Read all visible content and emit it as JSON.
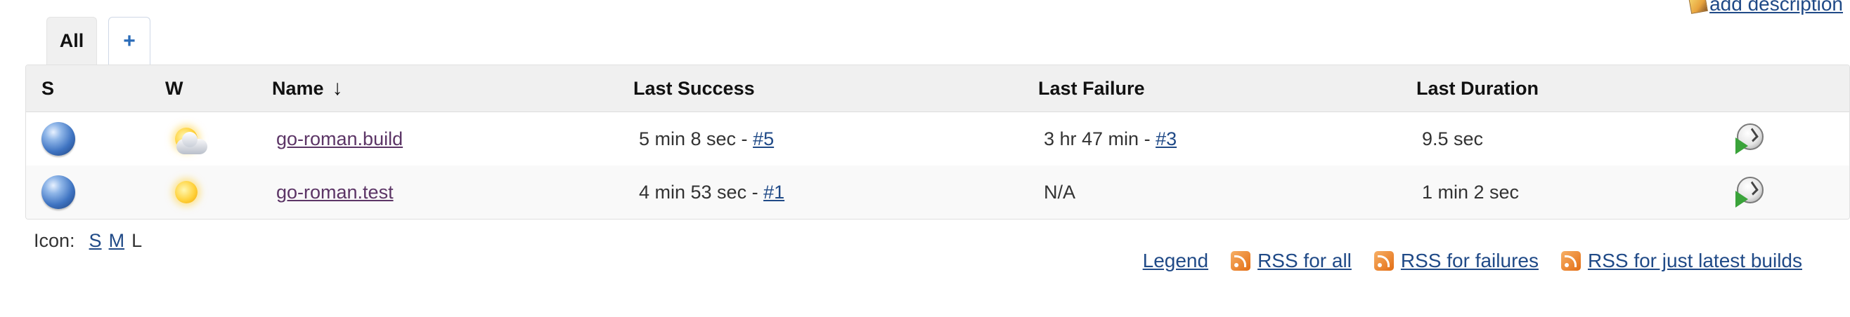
{
  "header": {
    "add_description": "add description"
  },
  "tabs": [
    {
      "label": "All",
      "active": true
    },
    {
      "label": "+",
      "active": false
    }
  ],
  "table": {
    "columns": {
      "status": "S",
      "weather": "W",
      "name": "Name",
      "name_sort_indicator": "↓",
      "last_success": "Last Success",
      "last_failure": "Last Failure",
      "last_duration": "Last Duration"
    },
    "rows": [
      {
        "status_icon": "blue-ball-icon",
        "weather_icon": "partly-cloudy-icon",
        "name": "go-roman.build",
        "last_success_time": "5 min 8 sec - ",
        "last_success_build": "#5",
        "last_failure_time": "3 hr 47 min - ",
        "last_failure_build": "#3",
        "last_duration": "9.5 sec",
        "action_icon": "schedule-build-icon"
      },
      {
        "status_icon": "blue-ball-icon",
        "weather_icon": "sunny-icon",
        "name": "go-roman.test",
        "last_success_time": "4 min 53 sec - ",
        "last_success_build": "#1",
        "last_failure_time": "N/A",
        "last_failure_build": "",
        "last_duration": "1 min 2 sec",
        "action_icon": "schedule-build-icon"
      }
    ]
  },
  "icon_size": {
    "label": "Icon:",
    "options": [
      "S",
      "M",
      "L"
    ],
    "selected": "L"
  },
  "footer": {
    "legend": "Legend",
    "rss_all": "RSS for all",
    "rss_failures": "RSS for failures",
    "rss_latest": "RSS for just latest builds"
  },
  "colors": {
    "link": "#204a87",
    "visited_link": "#5c3566",
    "header_bg": "#f0f0f0",
    "status_ball": "#3f74c2"
  }
}
